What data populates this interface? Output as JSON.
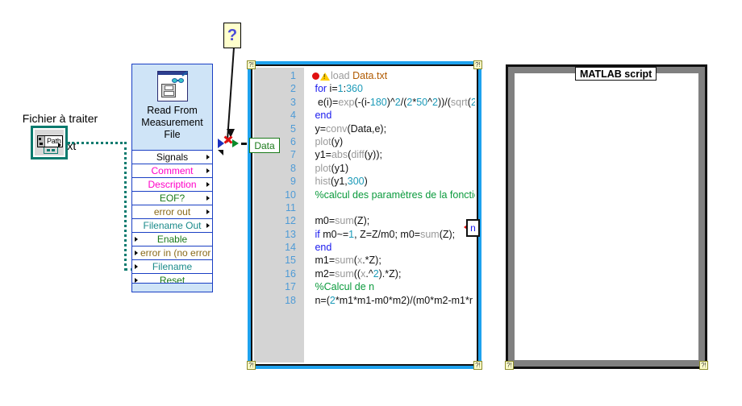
{
  "file_control": {
    "label_line1": "Fichier à traiter",
    "label_line2": "Data.txt",
    "path_value": "Path",
    "icon": "path-control-icon"
  },
  "vi_node": {
    "title": "Read From\nMeasurement\nFile",
    "icon": "read-measurement-file-icon",
    "terminals": [
      {
        "label": "Signals",
        "color": "#0a0a0a",
        "side": "out"
      },
      {
        "label": "Comment",
        "color": "#ff00c8",
        "side": "out"
      },
      {
        "label": "Description",
        "color": "#ff00c8",
        "side": "out"
      },
      {
        "label": "EOF?",
        "color": "#1a7a1a",
        "side": "out"
      },
      {
        "label": "error out",
        "color": "#8a6a1a",
        "side": "out"
      },
      {
        "label": "Filename Out",
        "color": "#1a8a8a",
        "side": "out"
      },
      {
        "label": "Enable",
        "color": "#1a7a1a",
        "side": "in"
      },
      {
        "label": "error in (no error",
        "color": "#8a6a1a",
        "side": "in",
        "align": "left"
      },
      {
        "label": "Filename",
        "color": "#1a8a8a",
        "side": "in"
      },
      {
        "label": "Reset",
        "color": "#1a7a1a",
        "side": "in"
      }
    ]
  },
  "tooltip": {
    "question_mark": "?"
  },
  "script_left": {
    "data_terminal": "Data",
    "output_terminal": "n",
    "resize_handle": "?!",
    "code_lines": [
      {
        "n": "1",
        "html": "<span class=\"bp\"></span><span class=\"warn\"></span><span class=\"fn\">load </span><span class=\"str\">Data.txt</span>"
      },
      {
        "n": "2",
        "html": "&nbsp;<span class=\"kw\">for</span> i=<span class=\"num\">1</span>:<span class=\"num\">360</span>"
      },
      {
        "n": "3",
        "html": "&nbsp;&nbsp;e(i)=<span class=\"fn\">exp</span>(-(i-<span class=\"num\">180</span>)^<span class=\"num\">2</span>/(<span class=\"num\">2</span>*<span class=\"num\">50</span>^<span class=\"num\">2</span>))/(<span class=\"fn\">sqrt</span>(<span class=\"num\">2</span>"
      },
      {
        "n": "4",
        "html": "&nbsp;<span class=\"kw\">end</span>"
      },
      {
        "n": "5",
        "html": "&nbsp;y=<span class=\"fn\">conv</span>(Data,e);"
      },
      {
        "n": "6",
        "html": "&nbsp;<span class=\"fn\">plot</span>(y)"
      },
      {
        "n": "7",
        "html": "&nbsp;y1=<span class=\"fn\">abs</span>(<span class=\"fn\">diff</span>(y));"
      },
      {
        "n": "8",
        "html": "&nbsp;<span class=\"fn\">plot</span>(y1)"
      },
      {
        "n": "9",
        "html": "&nbsp;<span class=\"fn\">hist</span>(y1,<span class=\"num\">300</span>)"
      },
      {
        "n": "10",
        "html": "&nbsp;<span class=\"cm\">%calcul des paramètres de la fonctior</span>"
      },
      {
        "n": "11",
        "html": "&nbsp;"
      },
      {
        "n": "12",
        "html": "&nbsp;m0=<span class=\"fn\">sum</span>(Z);"
      },
      {
        "n": "13",
        "html": "&nbsp;<span class=\"kw\">if</span> m0~=<span class=\"num\">1</span>, Z=Z/m0; m0=<span class=\"fn\">sum</span>(Z);"
      },
      {
        "n": "14",
        "html": "&nbsp;<span class=\"kw\">end</span>"
      },
      {
        "n": "15",
        "html": "&nbsp;m1=<span class=\"fn\">sum</span>(<span class=\"fn\">x</span>.*Z);"
      },
      {
        "n": "16",
        "html": "&nbsp;m2=<span class=\"fn\">sum</span>((<span class=\"fn\">x</span>.^<span class=\"num\">2</span>).*Z);"
      },
      {
        "n": "17",
        "html": "&nbsp;<span class=\"cm\">%Calcul de n</span>"
      },
      {
        "n": "18",
        "html": "&nbsp;n=(<span class=\"num\">2</span>*m1*m1-m0*m2)/(m0*m2-m1*r"
      }
    ],
    "code_plain": [
      "load Data.txt",
      " for i=1:360",
      "  e(i)=exp(-(i-180)^2/(2*50^2))/(sqrt(2",
      " end",
      " y=conv(Data,e);",
      " plot(y)",
      " y1=abs(diff(y));",
      " plot(y1)",
      " hist(y1,300)",
      " %calcul des paramètres de la fonctior",
      "",
      " m0=sum(Z);",
      " if m0~=1, Z=Z/m0; m0=sum(Z);",
      " end",
      " m1=sum(x.*Z);",
      " m2=sum((x.^2).*Z);",
      " %Calcul de n",
      " n=(2*m1*m1-m0*m2)/(m0*m2-m1*r"
    ]
  },
  "script_right": {
    "label": "MATLAB script",
    "resize_handle": "?!"
  },
  "colors": {
    "node_blue_fill": "#cfe4f7",
    "node_border": "#1a3fc4",
    "script_frame_blue": "#1ea2ee",
    "script_frame_gray": "#808080",
    "gutter": "#d4d4d4",
    "line_number": "#4f9bd6",
    "keyword": "#1a1aee",
    "comment": "#0a9a3c",
    "function": "#9a9a9a",
    "number": "#1b9ab8",
    "string": "#b05a00",
    "path_wire": "#0a7a6e",
    "error_red": "#e01010"
  }
}
